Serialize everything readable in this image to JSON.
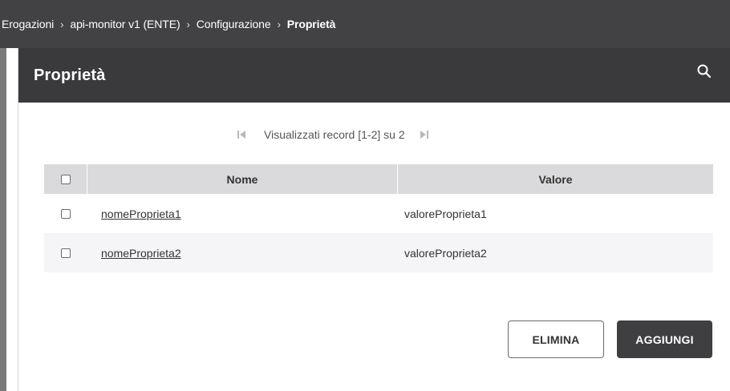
{
  "breadcrumb": {
    "items": [
      {
        "label": "Erogazioni"
      },
      {
        "label": "api-monitor v1 (ENTE)"
      },
      {
        "label": "Configurazione"
      },
      {
        "label": "Proprietà"
      }
    ],
    "separator": "›"
  },
  "card": {
    "title": "Proprietà",
    "search_icon": "search-icon"
  },
  "pagination": {
    "first_icon": "first-page-icon",
    "last_icon": "last-page-icon",
    "text": "Visualizzati record [1-2] su 2"
  },
  "table": {
    "columns": [
      "Nome",
      "Valore"
    ],
    "rows": [
      {
        "nome": "nomeProprieta1",
        "valore": "valoreProprieta1"
      },
      {
        "nome": "nomeProprieta2",
        "valore": "valoreProprieta2"
      }
    ]
  },
  "actions": {
    "delete_label": "ELIMINA",
    "add_label": "AGGIUNGI"
  },
  "colors": {
    "header_bg": "#424245",
    "card_header_bg": "#3a3a3d",
    "table_header_bg": "#dadadc",
    "primary_button_bg": "#3f3f42"
  }
}
